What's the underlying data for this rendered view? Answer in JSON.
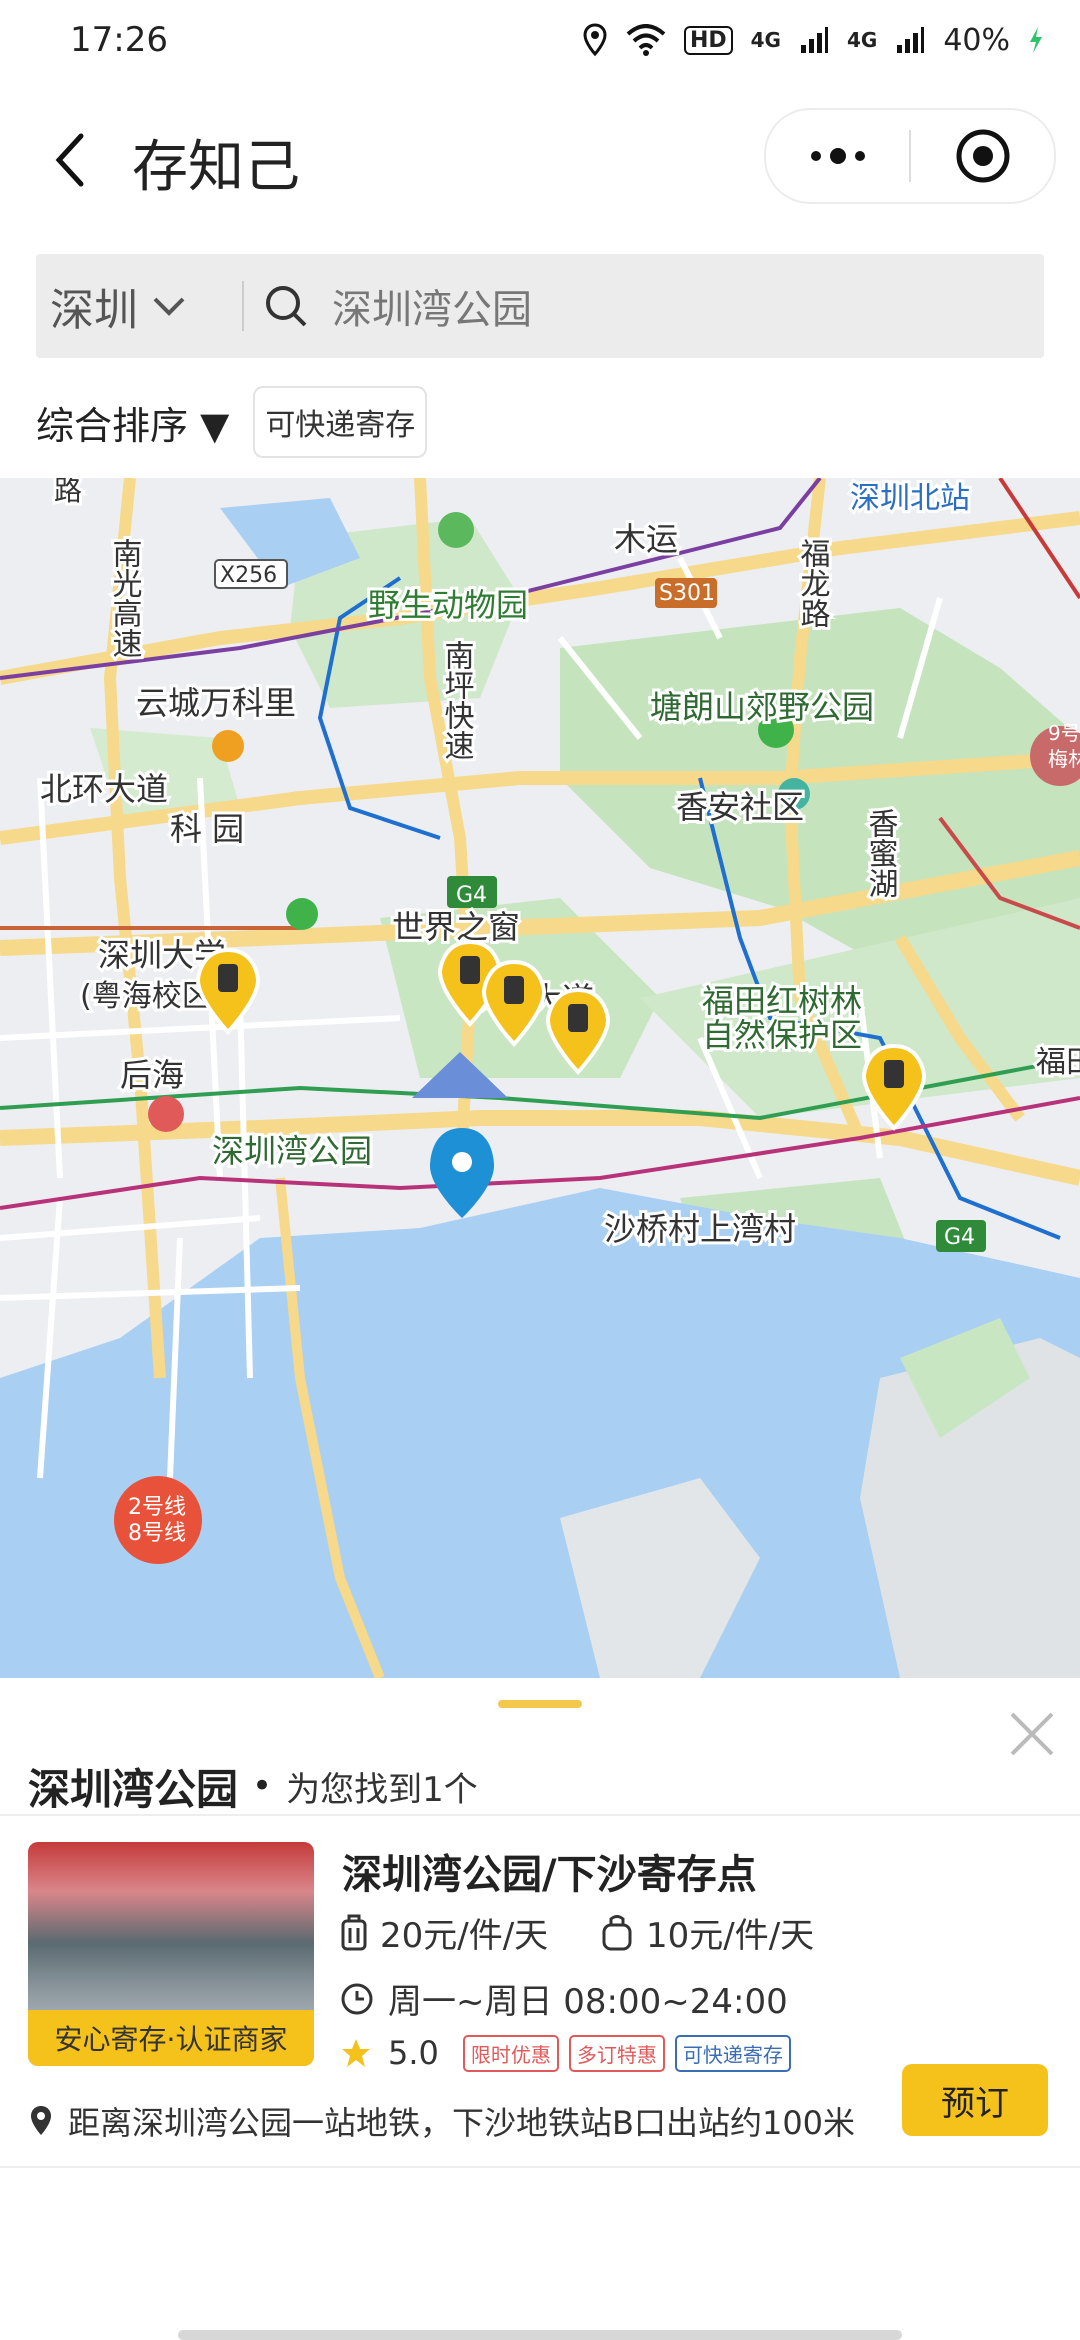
{
  "status_bar": {
    "time": "17:26",
    "hd_label": "HD",
    "net1": "4G",
    "net2": "4G",
    "battery": "40%"
  },
  "header": {
    "title": "存知己"
  },
  "search": {
    "city": "深圳",
    "query": "深圳湾公园"
  },
  "filters": {
    "sort_label": "综合排序 ▼",
    "chip_label": "可快递寄存"
  },
  "map": {
    "labels": {
      "north_station": "深圳北站",
      "nanguang": "南光高速",
      "x256": "X256",
      "zoo": "野生动物园",
      "muyun": "木运",
      "fulong": "福龙路",
      "s301": "S301",
      "nanping": "南坪快速",
      "tanglang": "塘朗山郊野公园",
      "yuncheng": "云城万科里",
      "g4a": "G4",
      "beihuan": "北环大道",
      "xiangan": "香安社区",
      "xiangmi": "香蜜湖",
      "ke_yuan": "科 园",
      "window": "世界之窗",
      "szu": "深圳大学",
      "szu_campus": "(粤海校区)",
      "binhai": "滨海大道",
      "mangrove1": "福田红树林",
      "mangrove2": "自然保护区",
      "g4b": "G4",
      "houhai": "后海",
      "bay_park": "深圳湾公园",
      "line_badge1": "2号线",
      "line_badge2": "8号线",
      "shaqiao": "沙桥村上湾村",
      "futian_edge": "福田",
      "line9_1": "9号",
      "line9_2": "梅林",
      "lu": "路"
    }
  },
  "sheet": {
    "title": "深圳湾公园",
    "dot": "•",
    "found": "为您找到1个"
  },
  "store": {
    "thumb_badge": "安心寄存·认证商家",
    "name": "深圳湾公园/下沙寄存点",
    "price1": "20元/件/天",
    "price2": "10元/件/天",
    "hours": "周一~周日 08:00~24:00",
    "rating": "5.0",
    "tag1": "限时优惠",
    "tag2": "多订特惠",
    "tag3": "可快递寄存",
    "address": "距离深圳湾公园一站地铁，下沙地铁站B口出站约100米",
    "book_label": "预订"
  },
  "colors": {
    "accent": "#f5c21b",
    "water": "#a9cff2",
    "park": "#c7e6c1",
    "pin_blue": "#1e90d6"
  }
}
